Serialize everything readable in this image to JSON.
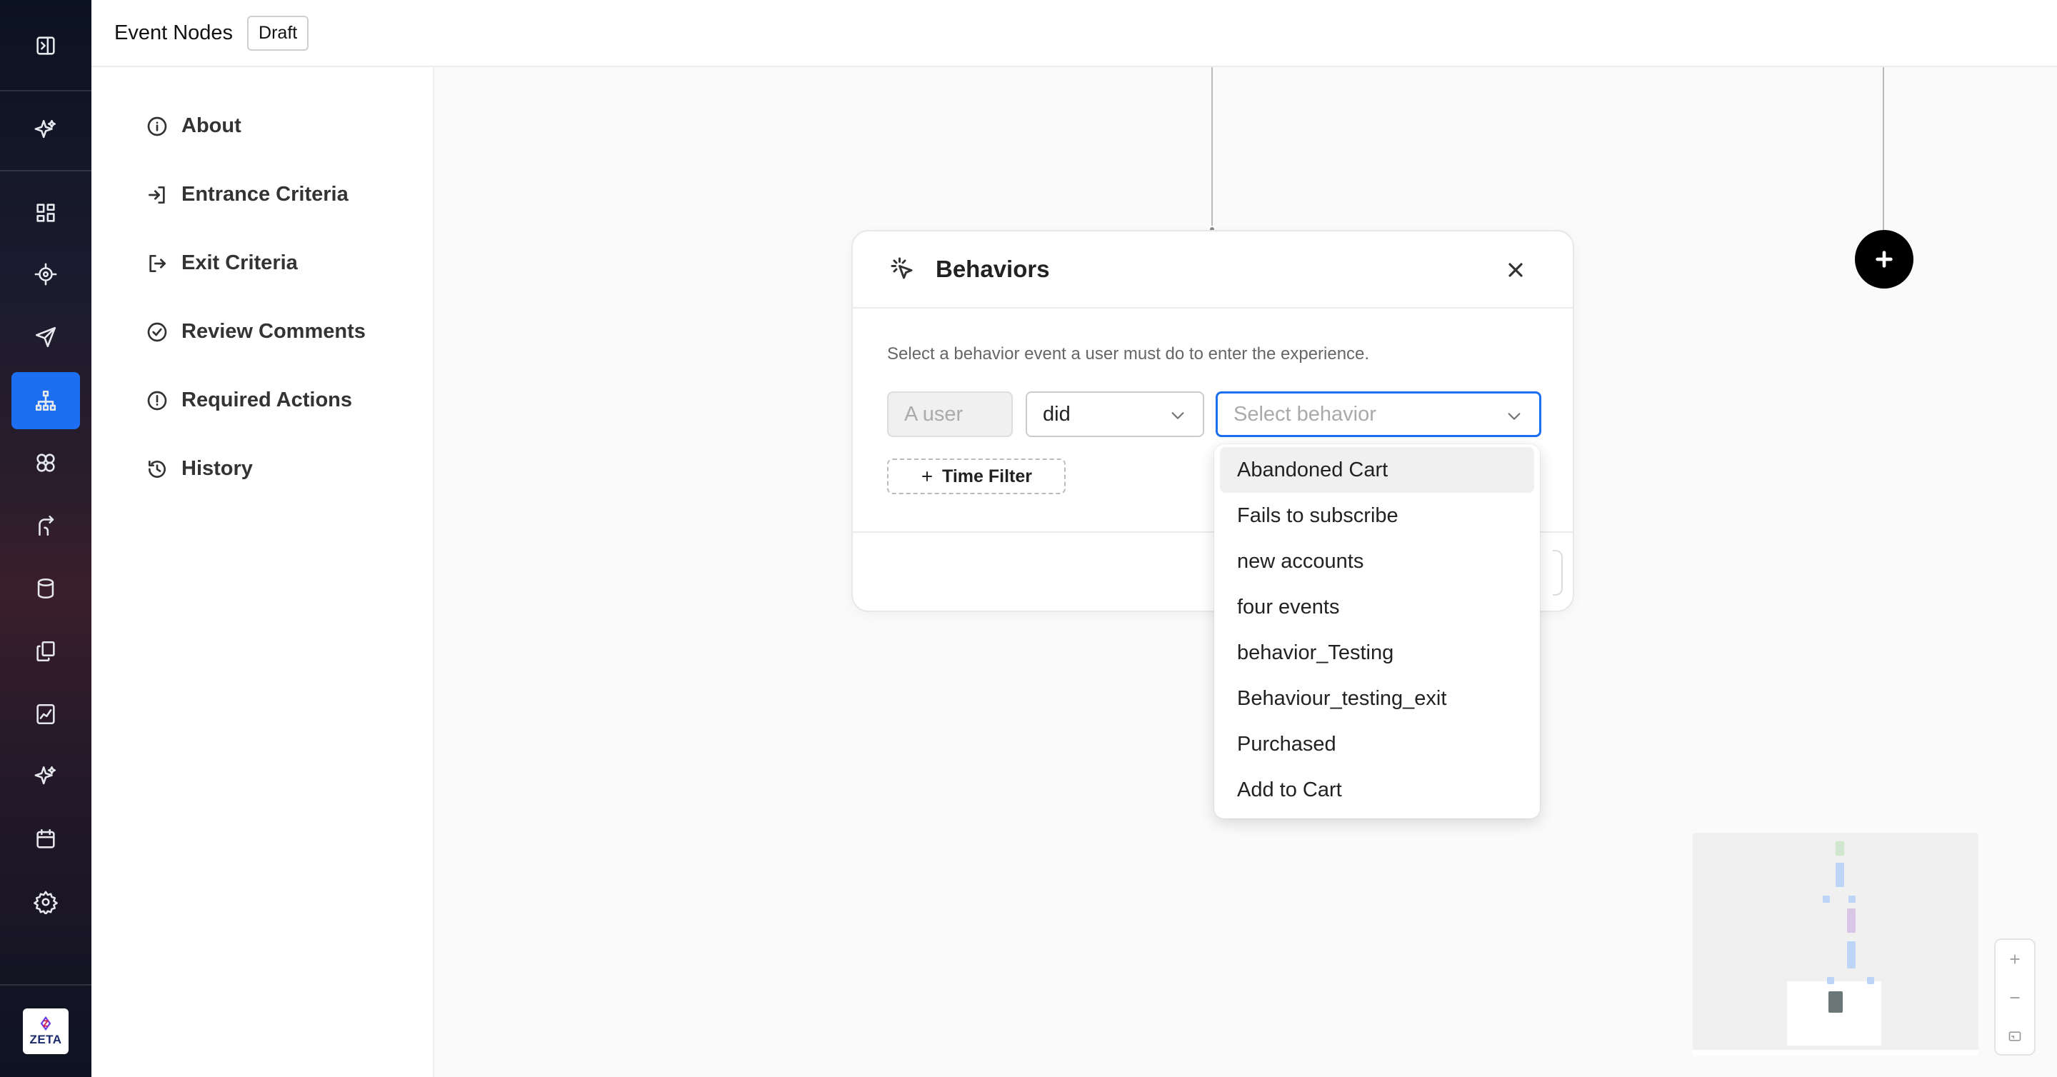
{
  "header": {
    "title": "Event Nodes",
    "status_badge": "Draft"
  },
  "rail": {
    "icons": [
      "collapse-sidebar-icon",
      "sparkle-icon",
      "dashboard-grid-icon",
      "target-icon",
      "send-icon",
      "org-chart-icon",
      "circles-icon",
      "route-icon",
      "database-icon",
      "copy-stack-icon",
      "chart-file-icon",
      "sparkle-icon",
      "calendar-icon",
      "gear-icon"
    ],
    "active_icon": "org-chart-icon",
    "active_color": "#1d6ff2",
    "logo_text": "ZETA"
  },
  "sidenav": {
    "items": [
      {
        "label": "About",
        "icon": "info-icon"
      },
      {
        "label": "Entrance Criteria",
        "icon": "sign-in-icon"
      },
      {
        "label": "Exit Criteria",
        "icon": "sign-out-icon"
      },
      {
        "label": "Review Comments",
        "icon": "check-circle-icon"
      },
      {
        "label": "Required Actions",
        "icon": "alert-circle-icon"
      },
      {
        "label": "History",
        "icon": "history-icon"
      }
    ]
  },
  "modal": {
    "title": "Behaviors",
    "title_icon": "cursor-click-icon",
    "description": "Select a behavior event a user must do to enter the experience.",
    "subject_placeholder": "A user",
    "verb_value": "did",
    "behavior_placeholder": "Select behavior",
    "time_filter_label": "Time Filter"
  },
  "behavior_options": [
    "Abandoned Cart",
    "Fails to subscribe",
    "new accounts",
    "four events",
    "behavior_Testing",
    "Behaviour_testing_exit",
    "Purchased",
    "Add to Cart"
  ],
  "highlighted_option": "Abandoned Cart",
  "colors": {
    "accent": "#1d6ff2",
    "add_node_button": "#000000"
  }
}
